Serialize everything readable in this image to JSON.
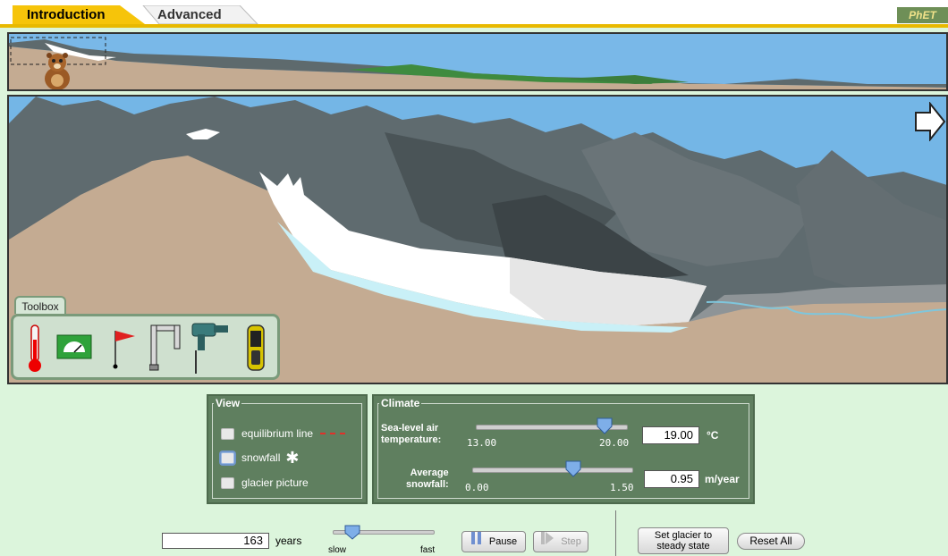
{
  "tabs": [
    {
      "label": "Introduction",
      "active": true
    },
    {
      "label": "Advanced",
      "active": false
    }
  ],
  "logo": {
    "text": "PhET"
  },
  "toolbox": {
    "label": "Toolbox",
    "tools": [
      {
        "icon": "thermometer-icon"
      },
      {
        "icon": "glacial-budget-meter-icon"
      },
      {
        "icon": "flag-icon"
      },
      {
        "icon": "ice-thickness-tool-icon"
      },
      {
        "icon": "borehole-drill-icon"
      },
      {
        "icon": "gps-receiver-icon"
      }
    ]
  },
  "view": {
    "title": "View",
    "options": [
      {
        "label": "equilibrium line",
        "checked": false
      },
      {
        "label": "snowfall",
        "checked": false
      },
      {
        "label": "glacier picture",
        "checked": false
      }
    ]
  },
  "climate": {
    "title": "Climate",
    "temperature": {
      "label_line1": "Sea-level air",
      "label_line2": "temperature:",
      "min": "13.00",
      "max": "20.00",
      "value": "19.00",
      "unit": "°C",
      "slider_fraction": 0.857
    },
    "snowfall": {
      "label_line1": "Average",
      "label_line2": "snowfall:",
      "min": "0.00",
      "max": "1.50",
      "value": "0.95",
      "unit": "m/year",
      "slider_fraction": 0.633
    }
  },
  "time": {
    "years_value": "163",
    "years_label": "years",
    "speed_slow": "slow",
    "speed_fast": "fast",
    "speed_fraction": 0.2
  },
  "buttons": {
    "pause": "Pause",
    "step": "Step",
    "steady_line1": "Set glacier to",
    "steady_line2": "steady state",
    "reset": "Reset All"
  },
  "colors": {
    "accent_tab": "#f6c40a",
    "sky": "#74b6e6",
    "ground": "#c4ab92",
    "mountain": "#5e6a6d",
    "ice": "#ffffff",
    "panel": "#5f7f5f",
    "background": "#dcf5dc"
  }
}
